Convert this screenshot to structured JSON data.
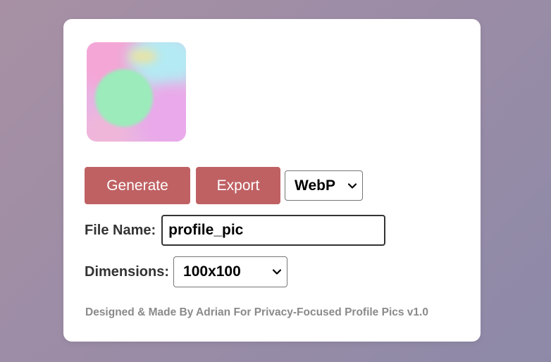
{
  "actions": {
    "generate_label": "Generate",
    "export_label": "Export",
    "format_selected": "WebP"
  },
  "file_name": {
    "label": "File Name:",
    "value": "profile_pic"
  },
  "dimensions": {
    "label": "Dimensions:",
    "selected": "100x100"
  },
  "footer": {
    "text": "Designed & Made By Adrian For Privacy-Focused Profile Pics v1.0"
  },
  "colors": {
    "button_bg": "#bf6163",
    "card_bg": "#ffffff",
    "preview_green": "#9aebb9",
    "preview_pink": "#f2a2d8",
    "preview_cyan": "#aeeaf2"
  }
}
